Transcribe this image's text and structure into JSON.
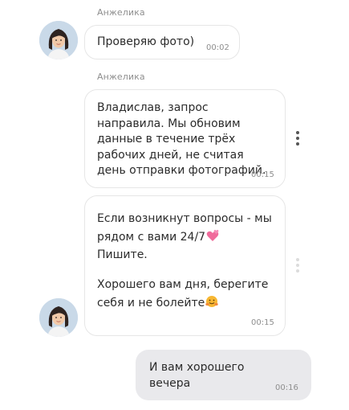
{
  "messages": [
    {
      "sender": "Анжелика",
      "text": "Проверяю фото)",
      "time": "00:02"
    },
    {
      "sender": "Анжелика",
      "text": "Владислав, запрос направила. Мы обновим данные в течение трёх рабочих дней, не считая день отправки фотографий.",
      "time": "00:15"
    },
    {
      "p1": "Если возникнут вопросы - мы рядом с вами 24/7",
      "p1_emoji": "two-hearts-emoji",
      "p1_after": "Пишите.",
      "p2": "Хорошего вам дня, берегите себя и не болейте",
      "p2_emoji": "hugging-face-emoji",
      "time": "00:15"
    },
    {
      "text": "И вам хорошего вечера",
      "time": "00:16"
    }
  ],
  "icons": {
    "avatar": "user-avatar",
    "more": "more-vertical-icon"
  },
  "colors": {
    "incoming_bubble": "#ffffff",
    "outgoing_bubble": "#e9e9ec",
    "meta_text": "#8e8e8e"
  }
}
